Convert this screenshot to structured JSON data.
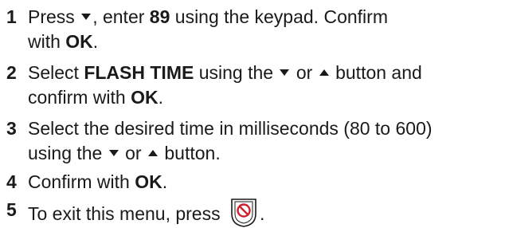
{
  "steps": [
    {
      "number": "1",
      "line1_pre": "Press",
      "line1_post": ", enter",
      "code": "89",
      "line1_end": "using the keypad. Confirm",
      "line2_pre": "with",
      "ok": "OK",
      "line2_end": "."
    },
    {
      "number": "2",
      "line1_pre": "Select",
      "item": "FLASH TIME",
      "line1_mid": "using the",
      "line1_or": "or",
      "line1_end": "button and",
      "line2_pre": "confirm with",
      "ok": "OK",
      "line2_end": "."
    },
    {
      "number": "3",
      "line1": "Select the desired time in milliseconds (80 to 600)",
      "line2_pre": "using the",
      "line2_or": "or",
      "line2_end": "button."
    },
    {
      "number": "4",
      "pre": "Confirm with",
      "ok": "OK",
      "end": "."
    },
    {
      "number": "5",
      "pre": "To exit this menu, press",
      "end": "."
    }
  ],
  "icons": {
    "down": "down-arrow-button-icon",
    "up": "up-arrow-button-icon",
    "exit": "red-exit-key-icon"
  },
  "colors": {
    "text": "#1a1a1a",
    "exit_key": "#d02030"
  }
}
